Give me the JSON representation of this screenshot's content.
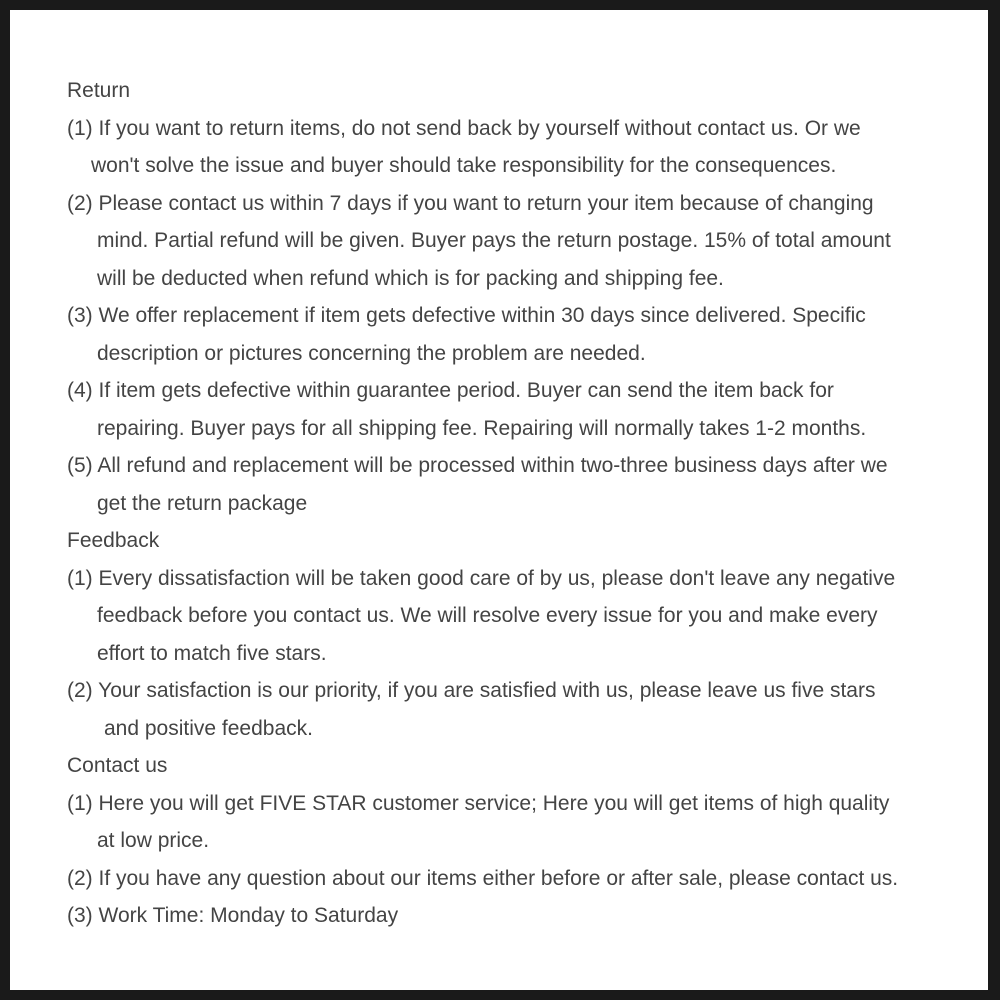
{
  "lines": [
    {
      "text": "Return",
      "indent": 0
    },
    {
      "text": "(1) If you want to return items, do not send back by yourself without contact us. Or we",
      "indent": 0
    },
    {
      "text": "won't solve the issue and buyer should take responsibility for the consequences.",
      "indent": 24
    },
    {
      "text": "(2) Please contact us within 7 days if you want to return your item because of changing",
      "indent": 0
    },
    {
      "text": "mind. Partial refund will be given. Buyer pays the return postage. 15% of total amount",
      "indent": 30
    },
    {
      "text": "will be deducted when refund which is for packing and shipping fee.",
      "indent": 30
    },
    {
      "text": "(3) We offer replacement if item gets defective within 30 days since delivered. Specific",
      "indent": 0
    },
    {
      "text": "description or pictures concerning the problem are needed.",
      "indent": 30
    },
    {
      "text": "(4) If item gets defective within guarantee period. Buyer can send the item back for",
      "indent": 0
    },
    {
      "text": "repairing. Buyer pays for all shipping fee. Repairing will normally takes 1-2 months.",
      "indent": 30
    },
    {
      "text": "(5) All refund and replacement will be processed within two-three business days after we",
      "indent": 0
    },
    {
      "text": "get the return package",
      "indent": 30
    },
    {
      "text": "Feedback",
      "indent": 0
    },
    {
      "text": "(1) Every dissatisfaction will be taken good care of by us, please don't leave any negative",
      "indent": 0
    },
    {
      "text": "feedback before you contact us. We will resolve every issue for you and make every",
      "indent": 30
    },
    {
      "text": "effort to match five stars.",
      "indent": 30
    },
    {
      "text": "(2) Your satisfaction is our priority, if you are satisfied with us, please leave us five stars",
      "indent": 0
    },
    {
      "text": "and positive feedback.",
      "indent": 37
    },
    {
      "text": "Contact us",
      "indent": 0
    },
    {
      "text": "(1) Here you will get FIVE STAR customer service; Here you will get items of high quality",
      "indent": 0
    },
    {
      "text": "at low price.",
      "indent": 30
    },
    {
      "text": "(2) If you have any question about our items either before or after sale, please contact us.",
      "indent": 0
    },
    {
      "text": "(3) Work Time: Monday to Saturday",
      "indent": 0
    }
  ]
}
